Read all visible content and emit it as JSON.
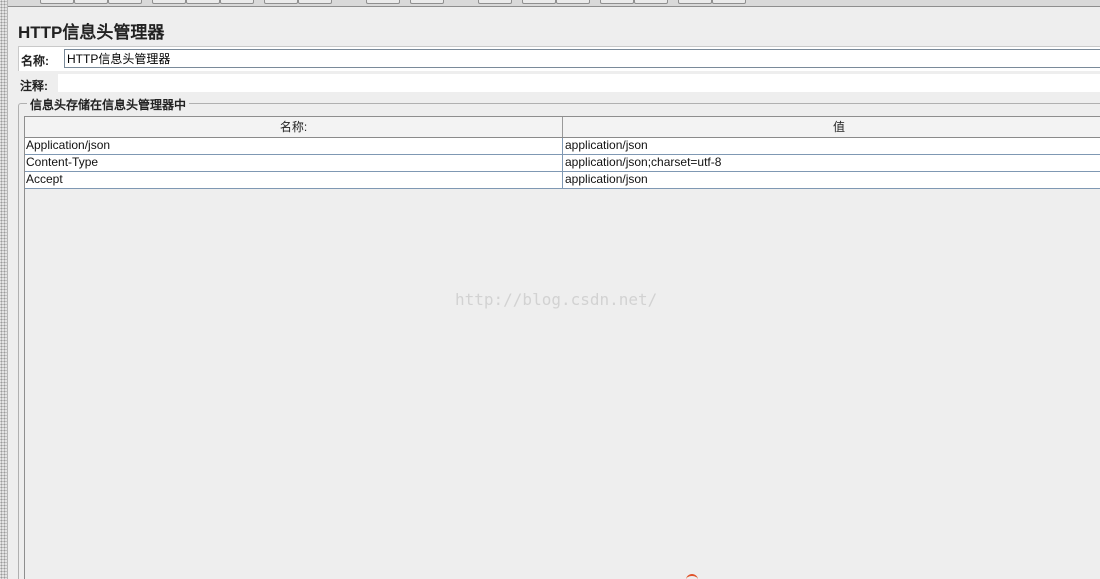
{
  "panel": {
    "title": "HTTP信息头管理器"
  },
  "name_row": {
    "label": "名称:",
    "value": "HTTP信息头管理器"
  },
  "comment_row": {
    "label": "注释:",
    "value": ""
  },
  "headers_group": {
    "title": "信息头存储在信息头管理器中",
    "columns": [
      "名称:",
      "值"
    ],
    "rows": [
      {
        "name": "Application/json",
        "value": "application/json"
      },
      {
        "name": "Content-Type",
        "value": "application/json;charset=utf-8"
      },
      {
        "name": "Accept",
        "value": "application/json"
      }
    ]
  },
  "watermark": {
    "text": "http://blog.csdn.net/"
  },
  "colors": {
    "background": "#eeeeee",
    "table_grid": "#7f98b3",
    "watermark": "#d2d2d2"
  }
}
